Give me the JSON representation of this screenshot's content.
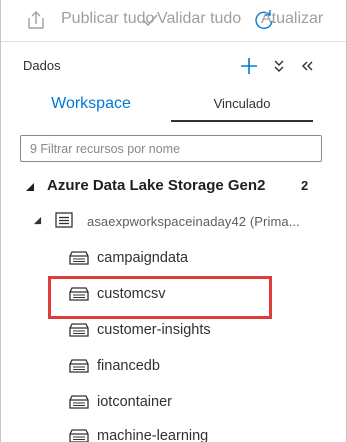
{
  "toolbar": {
    "publish_all_label": "Publicar tudo",
    "validate_all_label": "Validar tudo",
    "refresh_label": "Atualizar",
    "publish_icon": "upload-icon",
    "validate_icon": "check-icon",
    "refresh_icon": "refresh-icon"
  },
  "pane": {
    "title": "Dados",
    "add_icon": "plus-icon",
    "collapse_all_icon": "double-chevron-down-icon",
    "collapse_pane_icon": "double-chevron-left-icon"
  },
  "tabs": [
    {
      "label": "Workspace",
      "selected": false
    },
    {
      "label": "Vinculado",
      "selected": true
    }
  ],
  "filter": {
    "placeholder": "9 Filtrar recursos por nome",
    "value": ""
  },
  "tree": {
    "section": {
      "label": "Azure Data Lake Storage Gen2",
      "count": "2",
      "expanded": true
    },
    "account": {
      "label": "asaexpworkspaceinaday42 (Prima...",
      "icon": "storage-account-icon",
      "expanded": true
    },
    "containers": [
      {
        "label": "campaigndata",
        "icon": "container-icon"
      },
      {
        "label": "customcsv",
        "icon": "container-icon",
        "highlighted": true
      },
      {
        "label": "customer-insights",
        "icon": "container-icon"
      },
      {
        "label": "financedb",
        "icon": "container-icon"
      },
      {
        "label": "iotcontainer",
        "icon": "container-icon"
      },
      {
        "label": "machine-learning",
        "icon": "container-icon"
      }
    ]
  },
  "colors": {
    "accent": "#0078d4",
    "highlight_border": "#e03c3c",
    "toolbar_text": "#a19f9d"
  }
}
